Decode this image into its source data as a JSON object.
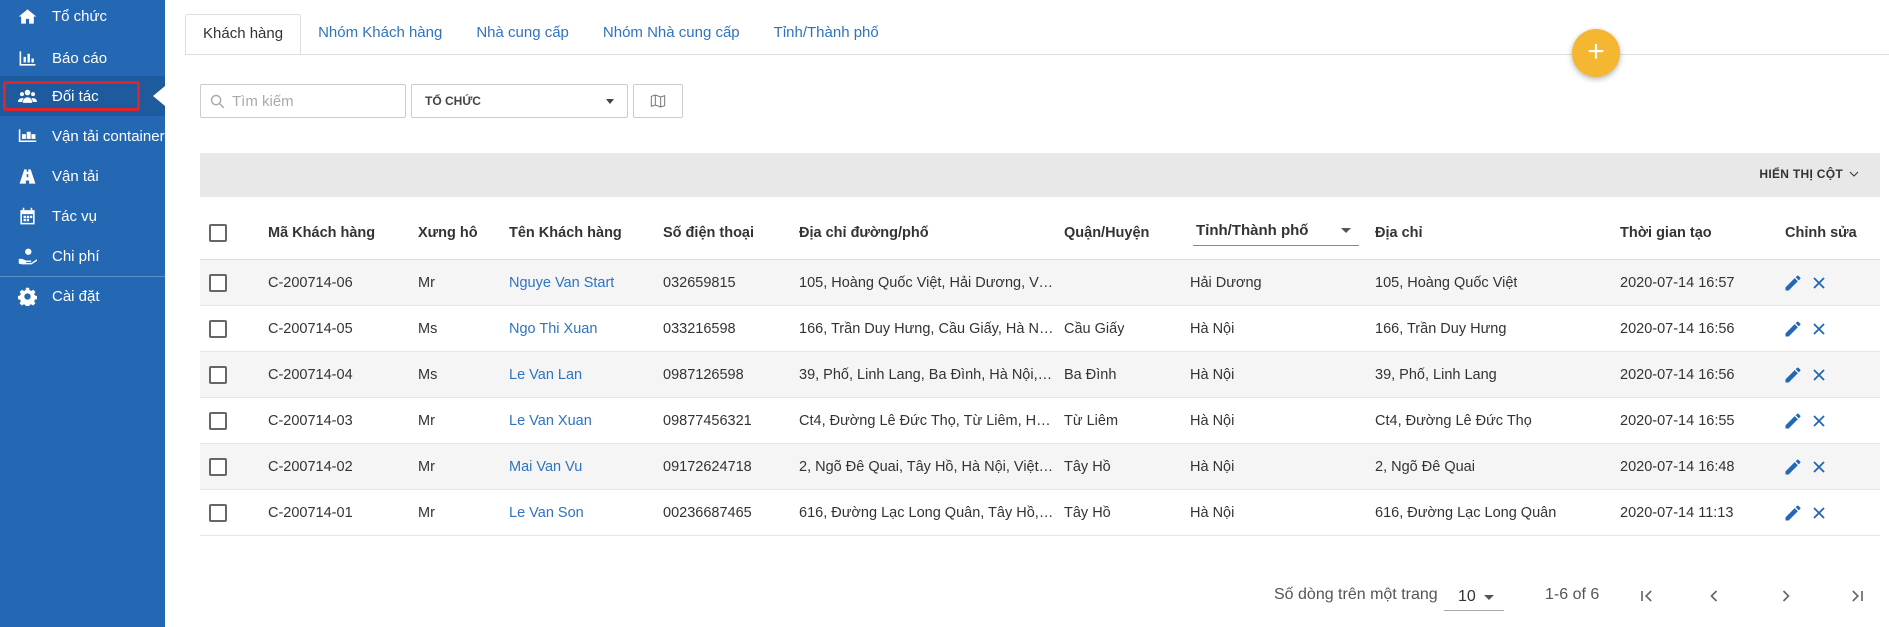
{
  "sidebar": {
    "items": [
      {
        "label": "Tổ chức",
        "icon": "home-icon"
      },
      {
        "label": "Báo cáo",
        "icon": "bar-chart-icon"
      },
      {
        "label": "Đối tác",
        "icon": "users-icon",
        "active": true
      },
      {
        "label": "Vận tải container",
        "icon": "container-icon"
      },
      {
        "label": "Vận tải",
        "icon": "road-icon"
      },
      {
        "label": "Tác vụ",
        "icon": "calendar-icon"
      },
      {
        "label": "Chi phí",
        "icon": "hand-money-icon"
      },
      {
        "label": "Cài đặt",
        "icon": "gear-icon"
      }
    ]
  },
  "tabs": [
    "Khách hàng",
    "Nhóm Khách hàng",
    "Nhà cung cấp",
    "Nhóm Nhà cung cấp",
    "Tỉnh/Thành phố"
  ],
  "fab": {
    "label": "+"
  },
  "filters": {
    "search_placeholder": "Tìm kiếm",
    "org_select": "TỔ CHỨC"
  },
  "toolbar": {
    "column_toggle": "HIỂN THỊ CỘT"
  },
  "table": {
    "headers": {
      "code": "Mã Khách hàng",
      "title": "Xưng hô",
      "name": "Tên Khách hàng",
      "phone": "Số điện thoại",
      "street": "Địa chỉ đường/phố",
      "district": "Quận/Huyện",
      "city": "Tỉnh/Thành phố",
      "address": "Địa chỉ",
      "created": "Thời gian tạo",
      "edit": "Chỉnh sửa"
    },
    "rows": [
      {
        "code": "C-200714-06",
        "title": "Mr",
        "name": "Nguye Van Start",
        "phone": "032659815",
        "street": "105, Hoàng Quốc Việt, Hải Dương, Việt…",
        "district": "",
        "city": "Hải Dương",
        "address": "105, Hoàng Quốc Việt",
        "created": "2020-07-14 16:57"
      },
      {
        "code": "C-200714-05",
        "title": "Ms",
        "name": "Ngo Thi Xuan",
        "phone": "033216598",
        "street": "166, Trần Duy Hưng, Cầu Giấy, Hà Nội, …",
        "district": "Cầu Giấy",
        "city": "Hà Nội",
        "address": "166, Trần Duy Hưng",
        "created": "2020-07-14 16:56"
      },
      {
        "code": "C-200714-04",
        "title": "Ms",
        "name": "Le Van Lan",
        "phone": "0987126598",
        "street": "39, Phố, Linh Lang, Ba Đình, Hà Nội, Vi…",
        "district": "Ba Đình",
        "city": "Hà Nội",
        "address": "39, Phố, Linh Lang",
        "created": "2020-07-14 16:56"
      },
      {
        "code": "C-200714-03",
        "title": "Mr",
        "name": "Le Van Xuan",
        "phone": "09877456321",
        "street": "Ct4, Đường Lê Đức Thọ, Từ Liêm, Hà N…",
        "district": "Từ Liêm",
        "city": "Hà Nội",
        "address": "Ct4, Đường Lê Đức Thọ",
        "created": "2020-07-14 16:55"
      },
      {
        "code": "C-200714-02",
        "title": "Mr",
        "name": "Mai Van Vu",
        "phone": "09172624718",
        "street": "2, Ngõ Đê Quai, Tây Hồ, Hà Nội, Việt N…",
        "district": "Tây Hồ",
        "city": "Hà Nội",
        "address": "2, Ngõ Đê Quai",
        "created": "2020-07-14 16:48"
      },
      {
        "code": "C-200714-01",
        "title": "Mr",
        "name": "Le Van Son",
        "phone": "00236687465",
        "street": "616, Đường Lạc Long Quân, Tây Hồ, H…",
        "district": "Tây Hồ",
        "city": "Hà Nội",
        "address": "616, Đường Lạc Long Quân",
        "created": "2020-07-14 11:13"
      }
    ]
  },
  "pagination": {
    "rows_per_page_label": "Số dòng trên một trang",
    "rows_per_page": "10",
    "range": "1-6 of 6"
  },
  "colors": {
    "sidebar": "#2468b4",
    "accent": "#f5b731",
    "link": "#2f73c0",
    "highlight": "#e0242b"
  }
}
